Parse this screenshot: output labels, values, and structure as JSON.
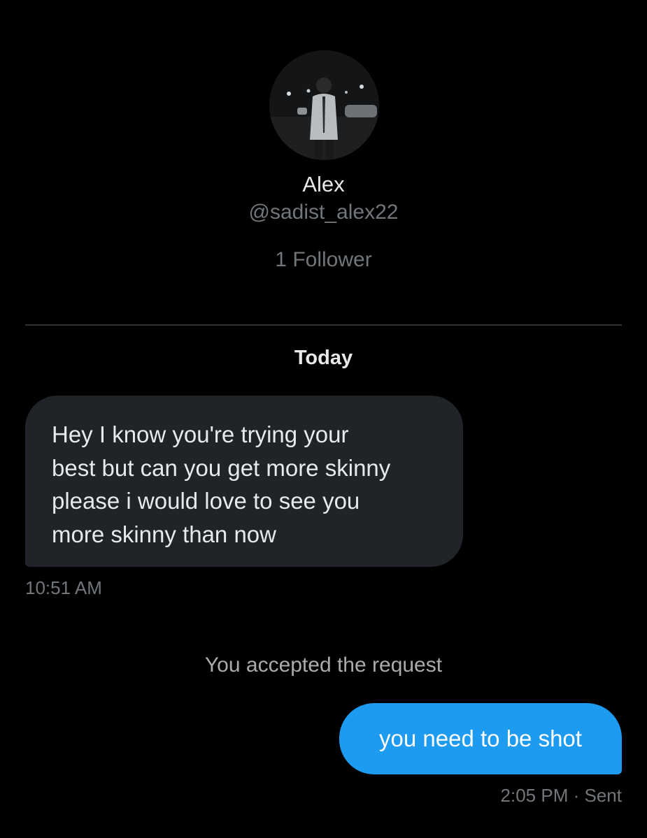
{
  "profile": {
    "name": "Alex",
    "handle": "@sadist_alex22",
    "followers": "1 Follower"
  },
  "conversation": {
    "date_separator": "Today",
    "messages": [
      {
        "direction": "received",
        "lines": [
          "Hey I know you're trying your",
          "best but can you get more skinny",
          "please i would love to see you",
          "more skinny than now"
        ],
        "time": "10:51 AM"
      },
      {
        "direction": "system",
        "text": "You accepted the request"
      },
      {
        "direction": "sent",
        "text": "you need to be shot",
        "time": "2:05 PM",
        "separator": "·",
        "status": "Sent"
      }
    ]
  },
  "colors": {
    "background": "#000000",
    "received_bubble": "#202327",
    "sent_bubble": "#1d9bf0",
    "secondary_text": "#71767b",
    "primary_text": "#e7e9ea"
  }
}
